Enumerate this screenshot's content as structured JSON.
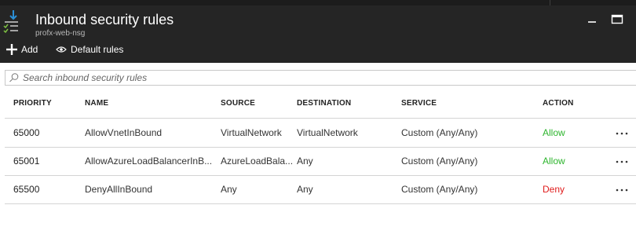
{
  "blade": {
    "title": "Inbound security rules",
    "subtitle": "profx-web-nsg"
  },
  "window_controls": {
    "minimize": "minimize-icon",
    "maximize": "maximize-icon"
  },
  "commands": {
    "add_label": "Add",
    "default_rules_label": "Default rules"
  },
  "search": {
    "placeholder": "Search inbound security rules",
    "value": ""
  },
  "table": {
    "columns": [
      "PRIORITY",
      "NAME",
      "SOURCE",
      "DESTINATION",
      "SERVICE",
      "ACTION"
    ],
    "rows": [
      {
        "priority": "65000",
        "name": "AllowVnetInBound",
        "source": "VirtualNetwork",
        "destination": "VirtualNetwork",
        "service": "Custom (Any/Any)",
        "action": "Allow"
      },
      {
        "priority": "65001",
        "name": "AllowAzureLoadBalancerInB...",
        "source": "AzureLoadBala...",
        "destination": "Any",
        "service": "Custom (Any/Any)",
        "action": "Allow"
      },
      {
        "priority": "65500",
        "name": "DenyAllInBound",
        "source": "Any",
        "destination": "Any",
        "service": "Custom (Any/Any)",
        "action": "Deny"
      }
    ]
  },
  "colors": {
    "header_bg": "#252525",
    "allow": "#2db52d",
    "deny": "#e01c1c",
    "icon_blue": "#2b8fd6",
    "icon_green": "#7ec242"
  }
}
